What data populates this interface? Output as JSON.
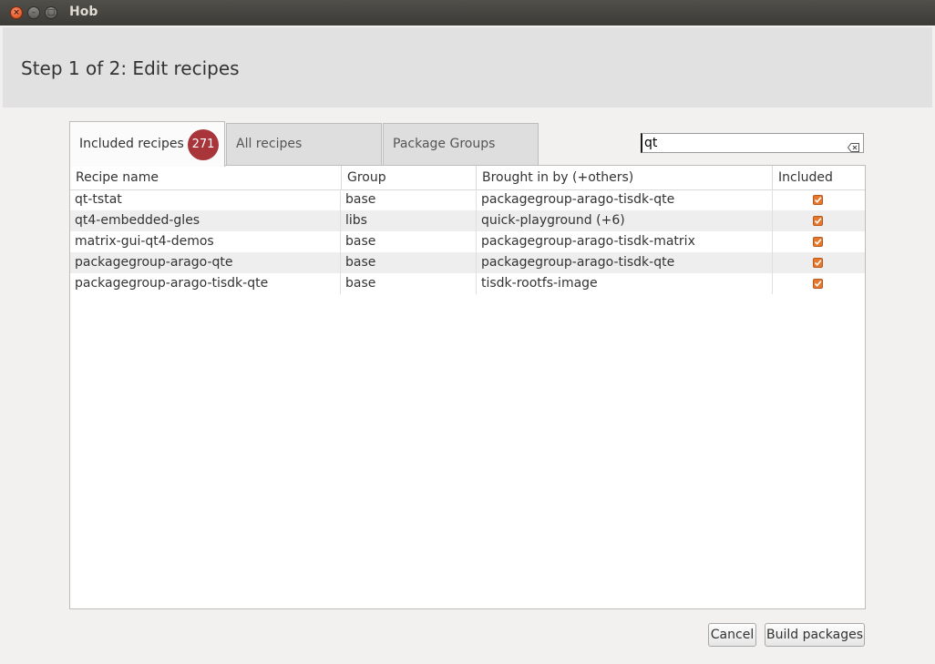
{
  "window": {
    "title": "Hob"
  },
  "header": {
    "step_title": "Step 1 of 2: Edit recipes"
  },
  "tabs": [
    {
      "label": "Included recipes",
      "badge": "271",
      "active": true
    },
    {
      "label": "All recipes",
      "active": false
    },
    {
      "label": "Package Groups",
      "active": false
    }
  ],
  "search": {
    "value": "qt"
  },
  "table": {
    "columns": [
      "Recipe name",
      "Group",
      "Brought in by (+others)",
      "Included"
    ],
    "rows": [
      {
        "name": "qt-tstat",
        "group": "base",
        "brought_in_by": "packagegroup-arago-tisdk-qte",
        "included": true
      },
      {
        "name": "qt4-embedded-gles",
        "group": "libs",
        "brought_in_by": "quick-playground (+6)",
        "included": true
      },
      {
        "name": "matrix-gui-qt4-demos",
        "group": "base",
        "brought_in_by": "packagegroup-arago-tisdk-matrix",
        "included": true
      },
      {
        "name": "packagegroup-arago-qte",
        "group": "base",
        "brought_in_by": "packagegroup-arago-tisdk-qte",
        "included": true
      },
      {
        "name": "packagegroup-arago-tisdk-qte",
        "group": "base",
        "brought_in_by": "tisdk-rootfs-image",
        "included": true
      }
    ]
  },
  "buttons": {
    "cancel": "Cancel",
    "build": "Build packages"
  },
  "colors": {
    "badge": "#a8353a",
    "checkbox": "#e6782e",
    "titlebar": "#3c3b37"
  }
}
